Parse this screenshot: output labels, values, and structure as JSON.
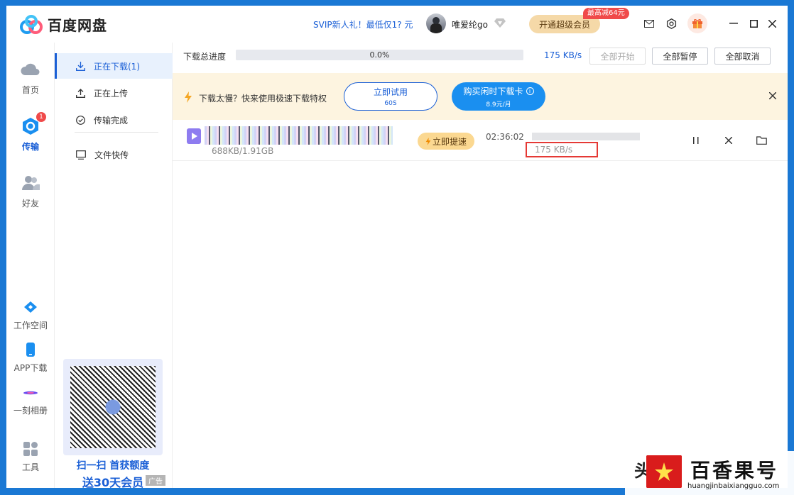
{
  "titlebar": {
    "app_name": "百度网盘",
    "promo": "SVIP新人礼！最低仅1? 元",
    "username": "唯爱纶go",
    "vip_button": "开通超级会员",
    "vip_tag": "最高减64元"
  },
  "nav": {
    "items": [
      {
        "label": "首页"
      },
      {
        "label": "传输",
        "badge": "1"
      },
      {
        "label": "好友"
      },
      {
        "label": "工作空间"
      },
      {
        "label": "APP下载"
      },
      {
        "label": "一刻相册"
      },
      {
        "label": "工具"
      }
    ]
  },
  "subnav": {
    "items": [
      {
        "label": "正在下载(1)"
      },
      {
        "label": "正在上传"
      },
      {
        "label": "传输完成"
      },
      {
        "label": "文件快传"
      }
    ],
    "qr_line1": "扫一扫 首获额度",
    "qr_line2": "送30天会员",
    "ad_tag": "广告"
  },
  "progress": {
    "label": "下载总进度",
    "percent_text": "0.0%",
    "percent_value": 0,
    "speed": "175 KB/s",
    "start_all": "全部开始",
    "pause_all": "全部暂停",
    "cancel_all": "全部取消"
  },
  "banner": {
    "text": "下载太慢？快来使用极速下载特权",
    "trial_label": "立即试用",
    "trial_sub": "60S",
    "buy_label": "购买闲时下载卡",
    "buy_sub": "8.9元/月"
  },
  "download": {
    "size": "688KB/1.91GB",
    "boost": "立即提速",
    "time_left": "02:36:02",
    "speed": "175 KB/s",
    "progress_value": 0
  },
  "watermark": {
    "left_char": "头",
    "title": "百香果号",
    "url": "huangjinbaixiangguo.com"
  },
  "colors": {
    "accent": "#1a5fd6",
    "banner_bg": "#fdf4e0",
    "vip_bg": "#f5d9a8",
    "badge_red": "#f04a4a",
    "highlight_box": "#e53935"
  }
}
